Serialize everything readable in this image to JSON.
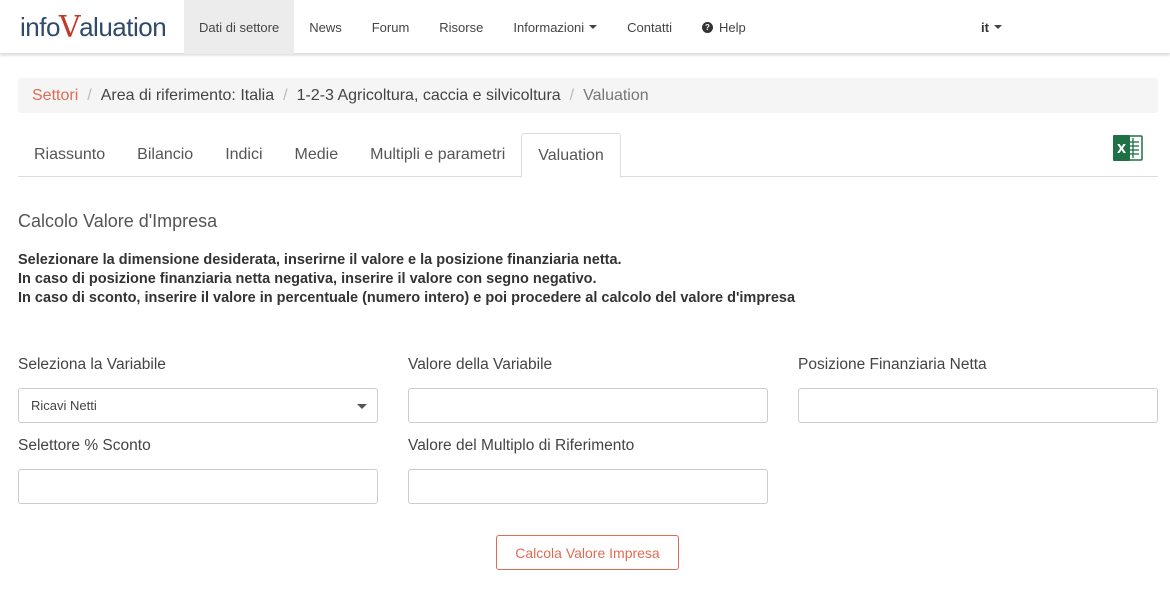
{
  "brand": {
    "part1": "info",
    "part2": "V",
    "part3": "aluation"
  },
  "nav": {
    "items": [
      {
        "label": "Dati di settore"
      },
      {
        "label": "News"
      },
      {
        "label": "Forum"
      },
      {
        "label": "Risorse"
      },
      {
        "label": "Informazioni"
      },
      {
        "label": "Contatti"
      },
      {
        "label": "Help"
      }
    ],
    "language": "it"
  },
  "breadcrumb": {
    "items": [
      "Settori",
      "Area di riferimento: Italia",
      "1-2-3 Agricoltura, caccia e silvicoltura",
      "Valuation"
    ],
    "separator": "/"
  },
  "tabs": [
    "Riassunto",
    "Bilancio",
    "Indici",
    "Medie",
    "Multipli e parametri",
    "Valuation"
  ],
  "active_tab": "Valuation",
  "excel_icon": {
    "name": "excel-export-icon",
    "letter": "X"
  },
  "calc": {
    "title": "Calcolo Valore d'Impresa",
    "instructions": [
      "Selezionare la dimensione desiderata, inserirne il valore e la posizione finanziaria netta.",
      "In caso di posizione finanziaria netta negativa, inserire il valore con segno negativo.",
      "In caso di sconto, inserire il valore in percentuale (numero intero) e poi procedere al calcolo del valore d'impresa"
    ],
    "fields": {
      "variable_label": "Seleziona la Variabile",
      "variable_selected": "Ricavi Netti",
      "value_label": "Valore della Variabile",
      "value": "",
      "pfn_label": "Posizione Finanziaria Netta",
      "pfn": "",
      "discount_label": "Selettore % Sconto",
      "discount": "",
      "multiple_label": "Valore del Multiplo di Riferimento",
      "multiple": ""
    },
    "button_label": "Calcola Valore Impresa"
  },
  "colors": {
    "accent": "#e06b55",
    "brand": "#2f4a6b",
    "brand_v": "#c0392b",
    "excel": "#1e7145"
  }
}
